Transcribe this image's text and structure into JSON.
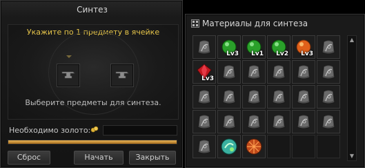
{
  "synthesis": {
    "title": "Синтез",
    "hint": "Укажите по 1 предмету в ячейке",
    "choose_text": "Выберите предметы для синтеза.",
    "gold_label": "Необходимо золото:",
    "gold_value": "",
    "progress_fraction": 1.0,
    "buttons": {
      "reset": "Сброс",
      "start": "Начать",
      "close": "Закрыть"
    },
    "colors": {
      "hint": "#e6c54a",
      "progress": "#d99a3a"
    }
  },
  "materials": {
    "title": "Материалы для синтеза",
    "rows": [
      [
        {
          "icon": "bracelet-icon",
          "lv": ""
        },
        {
          "icon": "green-gem-icon",
          "lv": "Lv3"
        },
        {
          "icon": "green-gem-icon",
          "lv": "Lv1"
        },
        {
          "icon": "green-gem-icon",
          "lv": "Lv2"
        },
        {
          "icon": "orange-gem-icon",
          "lv": "Lv3"
        },
        {
          "icon": "bracelet-icon",
          "lv": ""
        }
      ],
      [
        {
          "icon": "red-gem-icon",
          "lv": "Lv3"
        },
        {
          "icon": "bracelet-icon",
          "lv": ""
        },
        {
          "icon": "bracelet-icon",
          "lv": ""
        },
        {
          "icon": "bracelet-icon",
          "lv": ""
        },
        {
          "icon": "bracelet-icon",
          "lv": ""
        },
        {
          "icon": "bracelet-icon",
          "lv": ""
        }
      ],
      [
        {
          "icon": "bracelet-icon",
          "lv": ""
        },
        {
          "icon": "bracelet-icon",
          "lv": ""
        },
        {
          "icon": "bracelet-icon",
          "lv": ""
        },
        {
          "icon": "bracelet-icon",
          "lv": ""
        },
        {
          "icon": "bracelet-icon",
          "lv": ""
        },
        {
          "icon": "bracelet-icon",
          "lv": ""
        }
      ],
      [
        {
          "icon": "bracelet-icon",
          "lv": ""
        },
        {
          "icon": "bracelet-icon",
          "lv": ""
        },
        {
          "icon": "bracelet-icon",
          "lv": ""
        },
        {
          "icon": "bracelet-icon",
          "lv": ""
        },
        {
          "icon": "bracelet-icon",
          "lv": ""
        },
        {
          "icon": "bracelet-icon",
          "lv": ""
        }
      ],
      [
        {
          "icon": "bracelet-icon",
          "lv": ""
        },
        {
          "icon": "green-orb-icon",
          "lv": ""
        },
        {
          "icon": "orange-orb-icon",
          "lv": ""
        },
        {
          "icon": "empty",
          "lv": ""
        },
        {
          "icon": "empty",
          "lv": ""
        },
        {
          "icon": "empty",
          "lv": ""
        }
      ]
    ]
  }
}
